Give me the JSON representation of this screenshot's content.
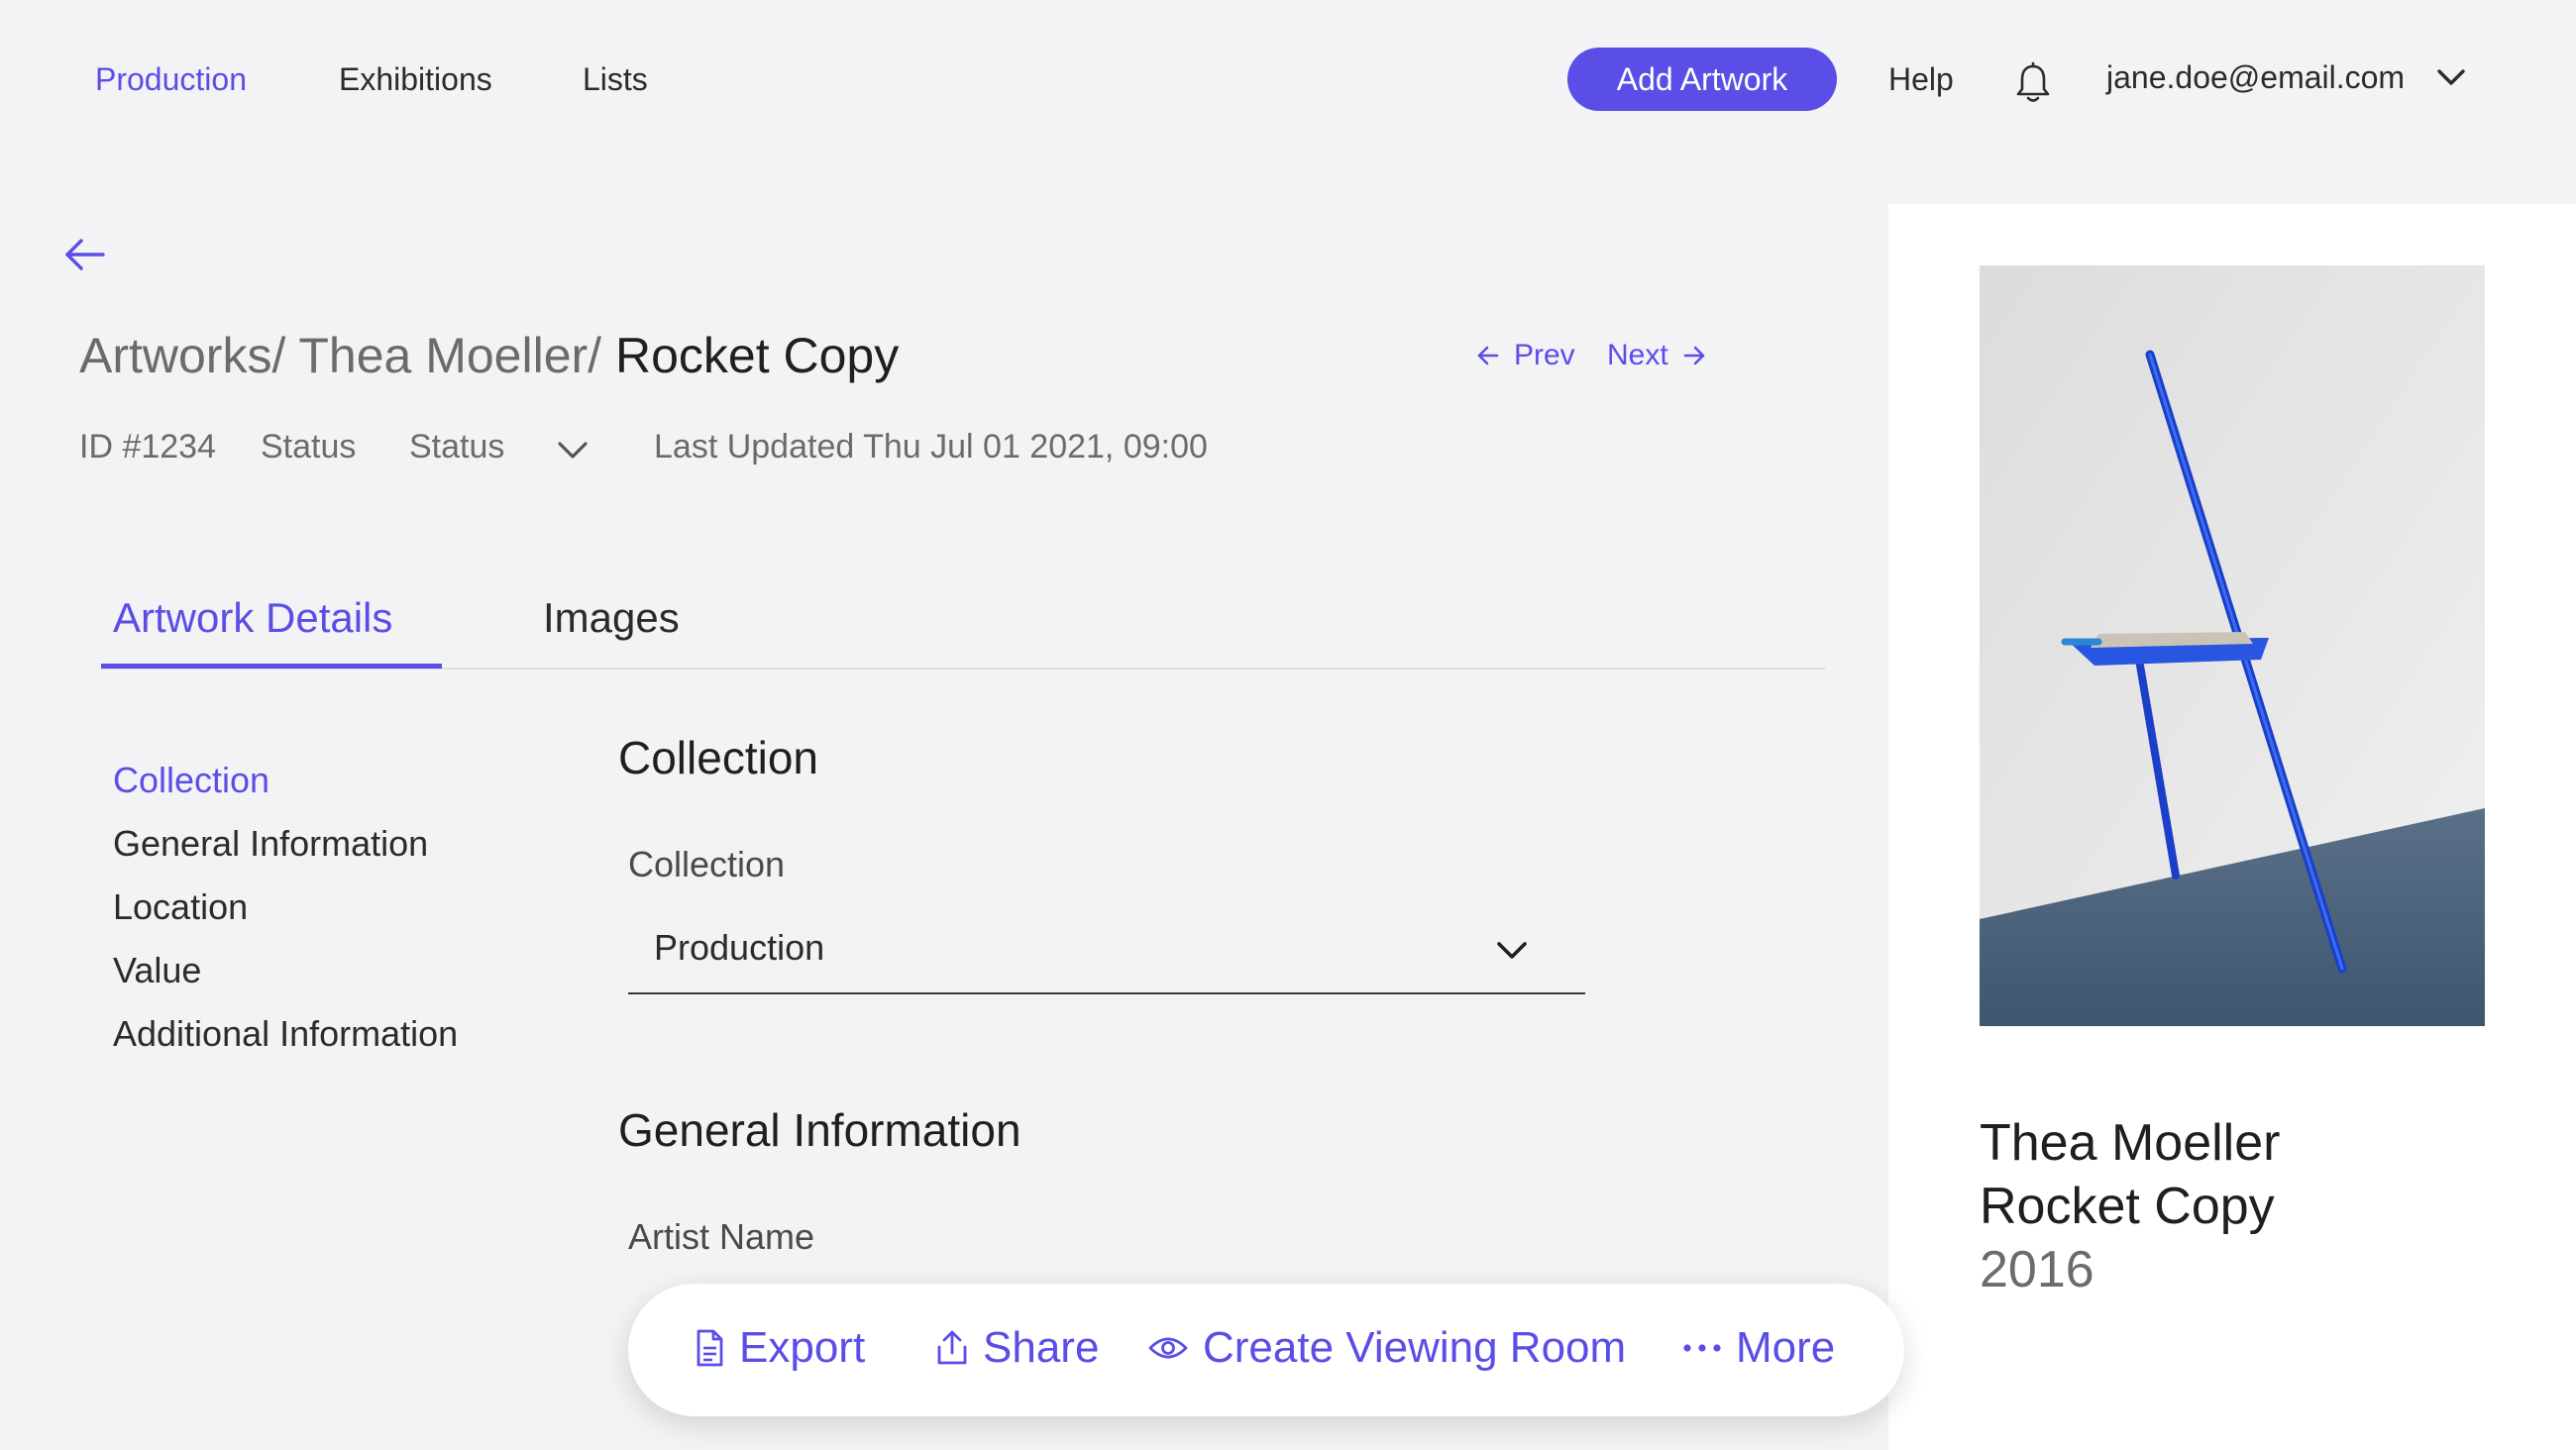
{
  "nav": {
    "items": [
      "Production",
      "Exhibitions",
      "Lists"
    ],
    "active": "Production",
    "add_button": "Add Artwork",
    "help": "Help",
    "notifications_icon": "bell-icon",
    "user_email": "jane.doe@email.com"
  },
  "breadcrumb": {
    "part1": "Artworks/",
    "part2": "Thea Moeller/",
    "current": "Rocket Copy"
  },
  "pager": {
    "prev": "Prev",
    "next": "Next"
  },
  "meta": {
    "id": "ID #1234",
    "status_label": "Status",
    "status_value": "Status",
    "last_updated": "Last Updated Thu Jul 01 2021, 09:00"
  },
  "tabs": [
    {
      "label": "Artwork Details",
      "active": true
    },
    {
      "label": "Images",
      "active": false
    }
  ],
  "sidenav": [
    {
      "label": "Collection",
      "active": true
    },
    {
      "label": "General Information",
      "active": false
    },
    {
      "label": "Location",
      "active": false
    },
    {
      "label": "Value",
      "active": false
    },
    {
      "label": "Additional Information",
      "active": false
    }
  ],
  "form": {
    "collection_section": "Collection",
    "collection_label": "Collection",
    "collection_value": "Production",
    "general_section": "General Information",
    "artist_name_label": "Artist Name"
  },
  "artwork": {
    "artist": "Thea Moeller",
    "title": "Rocket Copy",
    "year": "2016"
  },
  "actions": {
    "export": "Export",
    "share": "Share",
    "viewing_room": "Create Viewing Room",
    "more": "More"
  },
  "colors": {
    "accent": "#5b4ee6",
    "background": "#f3f3f5",
    "panel": "#ffffff"
  }
}
